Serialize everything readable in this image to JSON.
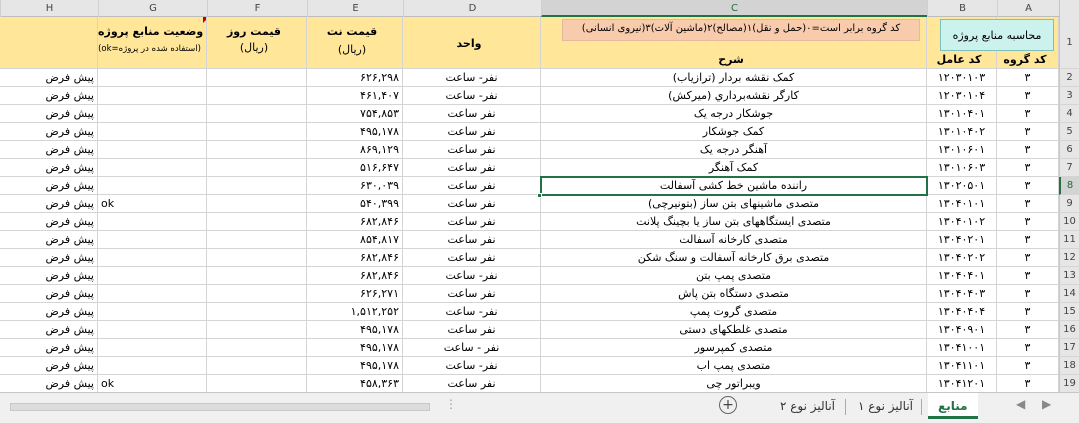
{
  "columns": [
    "H",
    "G",
    "F",
    "E",
    "D",
    "C",
    "B",
    "A"
  ],
  "selected_column": "C",
  "header": {
    "g_title": "وضعیت منابع پروژه",
    "g_sub": "(ok=استفاده شده در پروژه)",
    "f_title": "قیمت روز",
    "f_sub": "(ریال)",
    "e_title": "قیمت نت",
    "e_sub": "(ریال)",
    "d_title": "واحد",
    "c_note": "کد گروه برابر است=۰(حمل و نقل)۱(مصالح)۲(ماشین آلات)۳(نیروی انسانی)",
    "c_title": "شرح",
    "b_title": "کد عامل",
    "a_title": "کد گروه",
    "calc_button": "محاسبه منابع پروژه"
  },
  "rows": [
    {
      "num": "1"
    },
    {
      "num": "2",
      "h": "پیش فرض",
      "g": "",
      "e": "۶۲۶,۲۹۸",
      "d": "نفر- ساعت",
      "c": "کمک نقشه بردار (ترازیاب)",
      "b": "۱۲۰۳۰۱۰۳",
      "a": "۳"
    },
    {
      "num": "3",
      "h": "پیش فرض",
      "g": "",
      "e": "۴۶۱,۴۰۷",
      "d": "نفر- ساعت",
      "c": "کارگر نقشه‌برداري (میرکش)",
      "b": "۱۲۰۳۰۱۰۴",
      "a": "۳"
    },
    {
      "num": "4",
      "h": "پیش فرض",
      "g": "",
      "e": "۷۵۴,۸۵۳",
      "d": "نفر ساعت",
      "c": "جوشکار درجه یک",
      "b": "۱۳۰۱۰۴۰۱",
      "a": "۳"
    },
    {
      "num": "5",
      "h": "پیش فرض",
      "g": "",
      "e": "۴۹۵,۱۷۸",
      "d": "نفر ساعت",
      "c": "کمک جوشکار",
      "b": "۱۳۰۱۰۴۰۲",
      "a": "۳"
    },
    {
      "num": "6",
      "h": "پیش فرض",
      "g": "",
      "e": "۸۶۹,۱۲۹",
      "d": "نفر ساعت",
      "c": "آهنگر درجه یک",
      "b": "۱۳۰۱۰۶۰۱",
      "a": "۳"
    },
    {
      "num": "7",
      "h": "پیش فرض",
      "g": "",
      "e": "۵۱۶,۶۴۷",
      "d": "نفر ساعت",
      "c": "کمک آهنگر",
      "b": "۱۳۰۱۰۶۰۳",
      "a": "۳"
    },
    {
      "num": "8",
      "h": "پیش فرض",
      "g": "",
      "e": "۶۳۰,۰۳۹",
      "d": "نفر ساعت",
      "c": "راننده ماشین خط کشی آسفالت",
      "b": "۱۳۰۲۰۵۰۱",
      "a": "۳"
    },
    {
      "num": "9",
      "h": "پیش فرض",
      "g": "ok",
      "e": "۵۴۰,۳۹۹",
      "d": "نفر ساعت",
      "c": "متصدی ماشینهای بتن ساز (بتونیرچی)",
      "b": "۱۳۰۴۰۱۰۱",
      "a": "۳"
    },
    {
      "num": "10",
      "h": "پیش فرض",
      "g": "",
      "e": "۶۸۲,۸۴۶",
      "d": "نفر ساعت",
      "c": "متصدی ایستگاههای بتن ساز یا بچینگ پلانت",
      "b": "۱۳۰۴۰۱۰۲",
      "a": "۳"
    },
    {
      "num": "11",
      "h": "پیش فرض",
      "g": "",
      "e": "۸۵۴,۸۱۷",
      "d": "نفر ساعت",
      "c": "متصدی کارخانه آسفالت",
      "b": "۱۳۰۴۰۲۰۱",
      "a": "۳"
    },
    {
      "num": "12",
      "h": "پیش فرض",
      "g": "",
      "e": "۶۸۲,۸۴۶",
      "d": "نفر ساعت",
      "c": "متصدی برق کارخانه آسفالت و سنگ شکن",
      "b": "۱۳۰۴۰۲۰۲",
      "a": "۳"
    },
    {
      "num": "13",
      "h": "پیش فرض",
      "g": "",
      "e": "۶۸۲,۸۴۶",
      "d": "نفر- ساعت",
      "c": "متصدی پمپ بتن",
      "b": "۱۳۰۴۰۴۰۱",
      "a": "۳"
    },
    {
      "num": "14",
      "h": "پیش فرض",
      "g": "",
      "e": "۶۲۶,۲۷۱",
      "d": "نفر ساعت",
      "c": "متصدی دستگاه بتن پاش",
      "b": "۱۳۰۴۰۴۰۳",
      "a": "۳"
    },
    {
      "num": "15",
      "h": "پیش فرض",
      "g": "",
      "e": "۱,۵۱۲,۲۵۲",
      "d": "نفر- ساعت",
      "c": "متصدی گروت پمپ",
      "b": "۱۳۰۴۰۴۰۴",
      "a": "۳"
    },
    {
      "num": "16",
      "h": "پیش فرض",
      "g": "",
      "e": "۴۹۵,۱۷۸",
      "d": "نفر ساعت",
      "c": "متصدی غلطکهای دستی",
      "b": "۱۳۰۴۰۹۰۱",
      "a": "۳"
    },
    {
      "num": "17",
      "h": "پیش فرض",
      "g": "",
      "e": "۴۹۵,۱۷۸",
      "d": "نفر - ساعت",
      "c": "متصدی کمپرسور",
      "b": "۱۳۰۴۱۰۰۱",
      "a": "۳"
    },
    {
      "num": "18",
      "h": "پیش فرض",
      "g": "",
      "e": "۴۹۵,۱۷۸",
      "d": "نفر- ساعت",
      "c": "متصدی پمپ اب",
      "b": "۱۳۰۴۱۱۰۱",
      "a": "۳"
    },
    {
      "num": "19",
      "h": "پیش فرض",
      "g": "ok",
      "e": "۴۵۸,۳۶۳",
      "d": "نفر ساعت",
      "c": "ویبراتور چی",
      "b": "۱۳۰۴۱۲۰۱",
      "a": "۳"
    }
  ],
  "tabs": {
    "active": "منابع",
    "tab2": "آنالیز نوع ۱",
    "tab3": "آنالیز نوع ۲",
    "add": "+"
  }
}
